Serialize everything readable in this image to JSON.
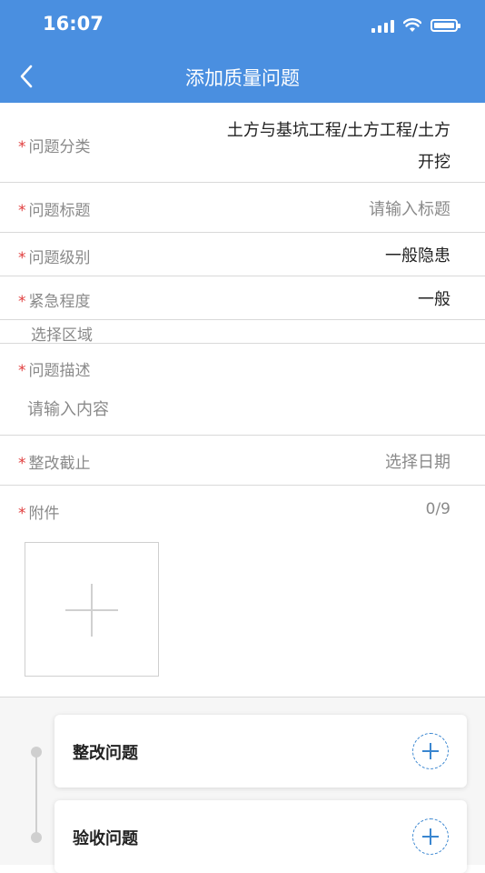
{
  "status_bar": {
    "time": "16:07"
  },
  "nav": {
    "title": "添加质量问题"
  },
  "form": {
    "category": {
      "label": "问题分类",
      "value_line1": "土方与基坑工程/土方工程/土方",
      "value_line2": "开挖"
    },
    "title": {
      "label": "问题标题",
      "placeholder": "请输入标题"
    },
    "level": {
      "label": "问题级别",
      "value": "一般隐患"
    },
    "urgency": {
      "label": "紧急程度",
      "value": "一般"
    },
    "area": {
      "label": "选择区域"
    },
    "description": {
      "label": "问题描述",
      "placeholder": "请输入内容"
    },
    "deadline": {
      "label": "整改截止",
      "placeholder": "选择日期"
    },
    "attachment": {
      "label": "附件",
      "count": "0/9"
    },
    "required_mark": "*"
  },
  "steps": [
    {
      "title": "整改问题"
    },
    {
      "title": "验收问题"
    }
  ],
  "colors": {
    "header": "#4a8fe0",
    "required": "#e03c3c",
    "accent": "#3a86d0"
  }
}
